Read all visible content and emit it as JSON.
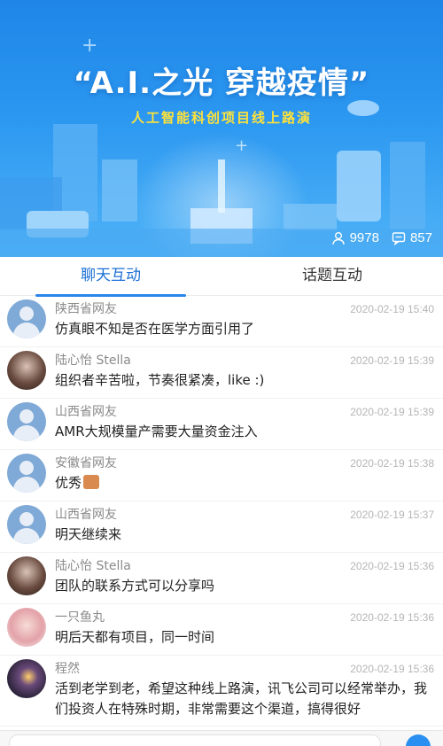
{
  "banner": {
    "title": "“A.I.之光 穿越疫情”",
    "subtitle": "人工智能科创项目线上路演",
    "viewers": "9978",
    "comments": "857"
  },
  "tabs": [
    {
      "label": "聊天互动",
      "active": true
    },
    {
      "label": "话题互动",
      "active": false
    }
  ],
  "messages": [
    {
      "name": "陕西省网友",
      "time": "2020-02-19 15:40",
      "text": "仿真眼不知是否在医学方面引用了",
      "avatar": "default-user-icon"
    },
    {
      "name": "陆心怡 Stella",
      "time": "2020-02-19 15:39",
      "text": "组织者辛苦啦，节奏很紧凑，like :)",
      "avatar": "photo"
    },
    {
      "name": "山西省网友",
      "time": "2020-02-19 15:39",
      "text": "AMR大规模量产需要大量资金注入",
      "avatar": "default-user-icon"
    },
    {
      "name": "安徽省网友",
      "time": "2020-02-19 15:38",
      "text": "优秀",
      "emoji": "thumbs-up",
      "avatar": "default-user-icon"
    },
    {
      "name": "山西省网友",
      "time": "2020-02-19 15:37",
      "text": "明天继续来",
      "avatar": "default-user-icon"
    },
    {
      "name": "陆心怡 Stella",
      "time": "2020-02-19 15:36",
      "text": "团队的联系方式可以分享吗",
      "avatar": "photo"
    },
    {
      "name": "一只鱼丸",
      "time": "2020-02-19 15:36",
      "text": "明后天都有项目，同一时间",
      "avatar": "photo"
    },
    {
      "name": "程然",
      "time": "2020-02-19 15:36",
      "text": "活到老学到老，希望这种线上路演，讯飞公司可以经常举办，我们投资人在特殊时期，非常需要这个渠道，搞得很好",
      "avatar": "photo"
    }
  ],
  "colors": {
    "accent": "#2a86ea",
    "banner_yellow": "#ffe23a"
  }
}
